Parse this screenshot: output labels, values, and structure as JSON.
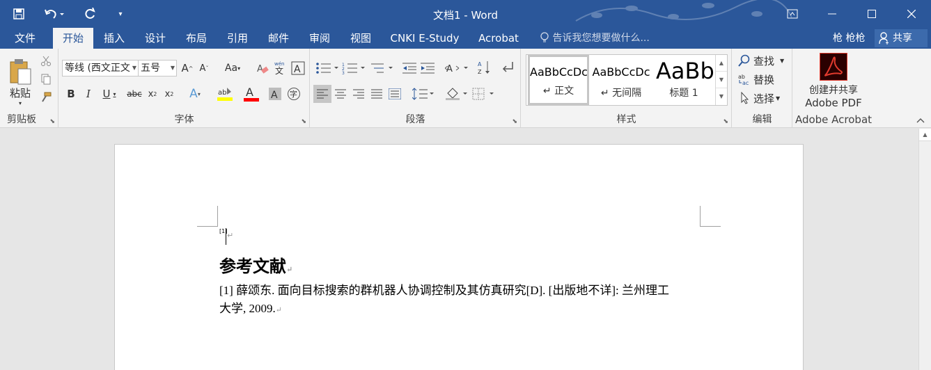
{
  "window": {
    "title": "文档1 - Word"
  },
  "tabs": [
    {
      "label": "文件",
      "active": false
    },
    {
      "label": "开始",
      "active": true
    },
    {
      "label": "插入",
      "active": false
    },
    {
      "label": "设计",
      "active": false
    },
    {
      "label": "布局",
      "active": false
    },
    {
      "label": "引用",
      "active": false
    },
    {
      "label": "邮件",
      "active": false
    },
    {
      "label": "审阅",
      "active": false
    },
    {
      "label": "视图",
      "active": false
    },
    {
      "label": "CNKI E-Study",
      "active": false
    },
    {
      "label": "Acrobat",
      "active": false
    }
  ],
  "tell_me": "告诉我您想要做什么...",
  "user_name": "枪 枪枪",
  "share_label": "共享",
  "ribbon": {
    "clipboard": {
      "paste_label": "粘贴",
      "group_label": "剪贴板"
    },
    "font": {
      "font_name": "等线 (西文正文",
      "font_size": "五号",
      "group_label": "字体"
    },
    "paragraph": {
      "group_label": "段落"
    },
    "styles": {
      "group_label": "样式",
      "items": [
        {
          "sample": "AaBbCcDc",
          "name": "↵ 正文"
        },
        {
          "sample": "AaBbCcDc",
          "name": "↵ 无间隔"
        },
        {
          "sample": "AaBb",
          "name": "标题 1"
        }
      ]
    },
    "editing": {
      "find": "查找",
      "replace": "替换",
      "select": "选择",
      "group_label": "编辑"
    },
    "acrobat": {
      "line1": "创建并共享",
      "line2": "Adobe PDF",
      "group_label": "Adobe Acrobat"
    }
  },
  "document": {
    "footnote_mark": "[1]",
    "heading": "参考文献",
    "reference_line1": "[1]  薛颂东.  面向目标搜索的群机器人协调控制及其仿真研究[D]. [出版地不详]:  兰州理工",
    "reference_line2": "大学, 2009."
  },
  "colors": {
    "brand": "#2b579a",
    "ribbon_bg": "#f3f3f3",
    "highlight_yellow": "#ffff00",
    "font_color_red": "#ff0000"
  }
}
